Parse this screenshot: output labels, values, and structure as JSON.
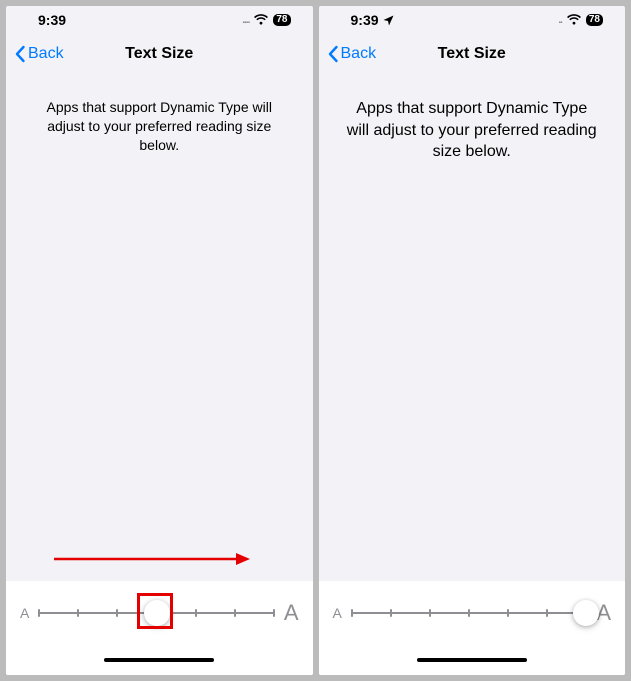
{
  "left": {
    "status": {
      "time": "9:39",
      "battery": "78",
      "showLocation": false
    },
    "nav": {
      "back": "Back",
      "title": "Text Size"
    },
    "description": "Apps that support Dynamic Type will adjust to your preferred reading size below.",
    "slider": {
      "smallLabel": "A",
      "largeLabel": "A",
      "steps": 7,
      "position": 3
    },
    "annotation": {
      "boxOnThumb": true,
      "arrow": true
    }
  },
  "right": {
    "status": {
      "time": "9:39",
      "battery": "78",
      "showLocation": true
    },
    "nav": {
      "back": "Back",
      "title": "Text Size"
    },
    "description": "Apps that support Dynamic Type will adjust to your preferred reading size below.",
    "slider": {
      "smallLabel": "A",
      "largeLabel": "A",
      "steps": 7,
      "position": 6
    },
    "annotation": {
      "boxOnThumb": false,
      "arrow": false
    }
  },
  "colors": {
    "accent": "#007aff",
    "annotation": "#e50000"
  }
}
